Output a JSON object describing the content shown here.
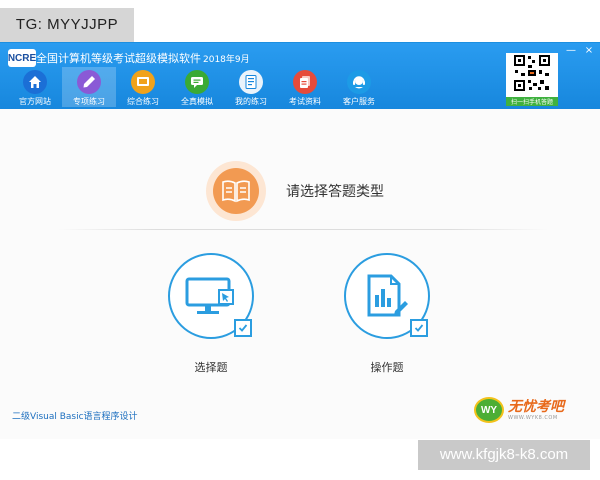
{
  "watermark_top": "TG: MYYJJPP",
  "watermark_bottom": "www.kfgjk8-k8.com",
  "app": {
    "logo_text": "NCRE",
    "title": "全国计算机等级考试超级模拟软件",
    "version": "2018年9月",
    "min_glyph": "—",
    "close_glyph": "×"
  },
  "nav": {
    "items": [
      {
        "label": "官方网站",
        "icon": "home-icon",
        "color": "#1b6fd6"
      },
      {
        "label": "专项练习",
        "icon": "pencil-icon",
        "color": "#8a5ad6"
      },
      {
        "label": "综合练习",
        "icon": "layers-icon",
        "color": "#f0a21b"
      },
      {
        "label": "全真模拟",
        "icon": "chat-icon",
        "color": "#3aaa35"
      },
      {
        "label": "我的练习",
        "icon": "document-icon",
        "color": "#eaf3fb"
      },
      {
        "label": "考试资料",
        "icon": "files-icon",
        "color": "#e64b3b"
      },
      {
        "label": "客户服务",
        "icon": "support-icon",
        "color": "#1d9be6"
      }
    ],
    "active_index": 1
  },
  "qr": {
    "label": "扫一扫手机答题"
  },
  "prompt": {
    "text": "请选择答题类型",
    "icon": "book-icon",
    "color": "#f29a52"
  },
  "choices": [
    {
      "label": "选择题",
      "icon": "monitor-icon"
    },
    {
      "label": "操作题",
      "icon": "edit-document-icon"
    }
  ],
  "footer": {
    "left_text": "二级Visual Basic语言程序设计",
    "brand_badge": "WY",
    "brand_name": "无忧考吧",
    "brand_url": "WWW.WYK8.COM"
  },
  "colors": {
    "titlebar": "#1787dd",
    "accent": "#2b9de0",
    "brand_orange": "#e8691b",
    "brand_green": "#4cae35"
  }
}
